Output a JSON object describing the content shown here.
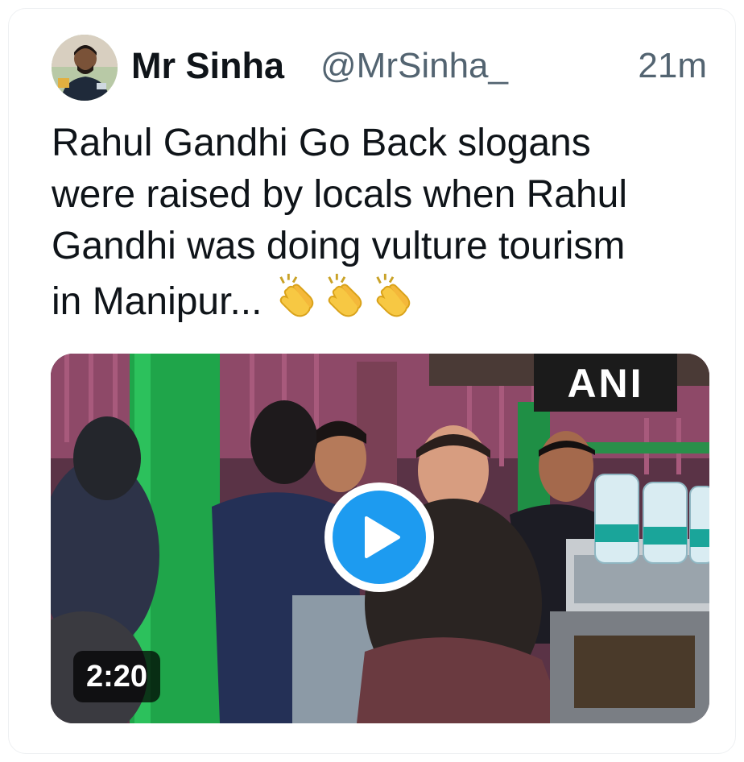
{
  "tweet": {
    "author_name": "Mr Sinha",
    "author_handle": "@MrSinha_",
    "timestamp": "21m",
    "text_lines": [
      "Rahul Gandhi Go Back slogans",
      "were raised by locals when Rahul",
      "Gandhi was doing vulture tourism",
      "in Manipur..."
    ],
    "emojis": [
      "clapping-hands-icon",
      "clapping-hands-icon",
      "clapping-hands-icon"
    ]
  },
  "media": {
    "watermark": "ANI",
    "duration": "2:20",
    "play_icon": "play-icon"
  },
  "colors": {
    "accent": "#1d9bf0",
    "text_primary": "#0f1419",
    "text_secondary": "#536471"
  }
}
